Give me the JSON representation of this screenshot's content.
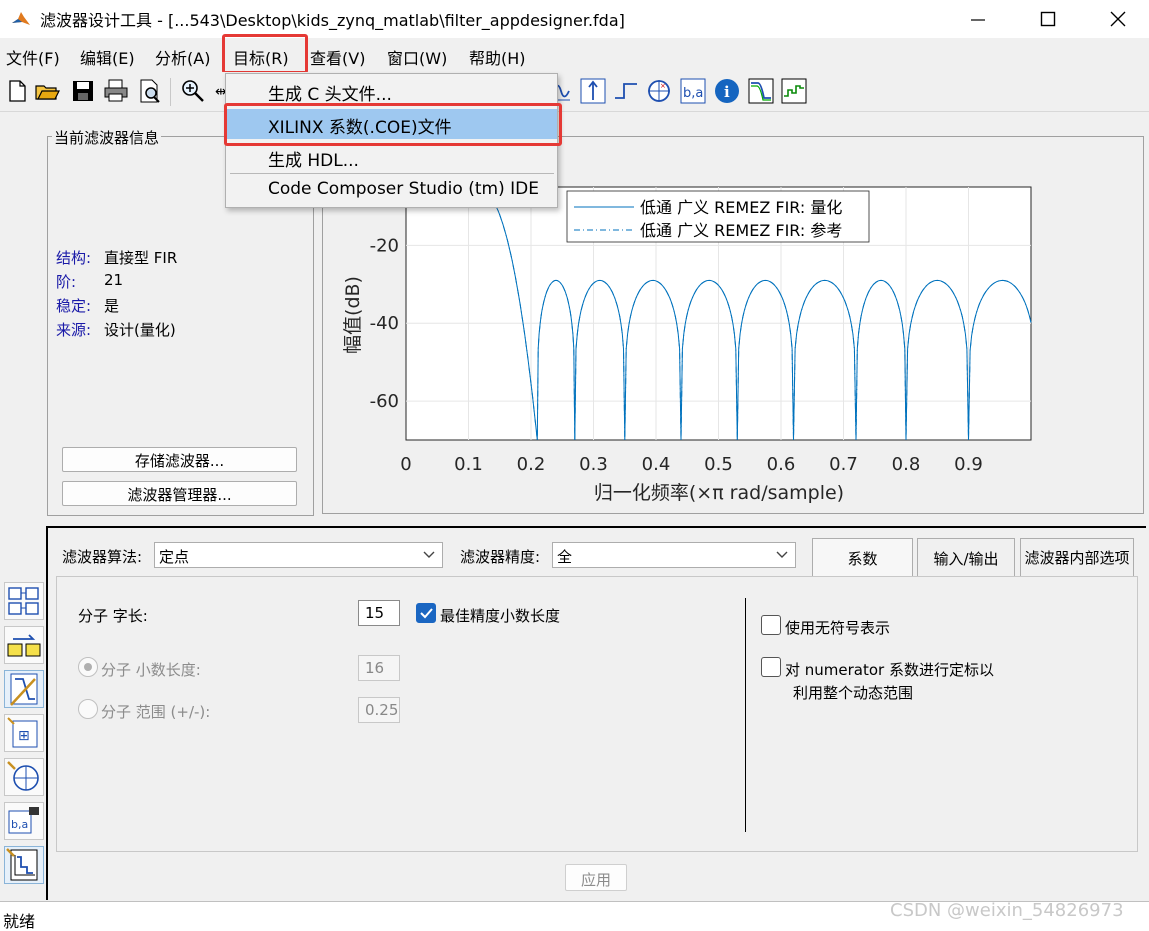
{
  "window": {
    "title": "滤波器设计工具 - [...543\\Desktop\\kids_zynq_matlab\\filter_appdesigner.fda]",
    "controls": [
      "minimize-icon",
      "maximize-icon",
      "close-icon"
    ]
  },
  "menubar": {
    "items": [
      "文件(F)",
      "编辑(E)",
      "分析(A)",
      "目标(R)",
      "查看(V)",
      "窗口(W)",
      "帮助(H)"
    ],
    "open_item": "目标(R)"
  },
  "target_menu": {
    "items": [
      "生成 C 头文件...",
      "XILINX 系数(.COE)文件",
      "生成 HDL...",
      "Code Composer Studio (tm) IDE"
    ],
    "highlighted": "XILINX 系数(.COE)文件"
  },
  "toolbar": {
    "icons": [
      "new-file-icon",
      "open-folder-icon",
      "save-icon",
      "print-icon",
      "print-preview-icon",
      "zoom-in-icon",
      "zoom-x-icon",
      "pole-zero-icon",
      "impulse-response-icon",
      "step-response-icon",
      "pole-zero-plot-icon",
      "filter-coefficients-icon",
      "info-icon",
      "group-delay-icon",
      "magnitude-estimate-icon"
    ]
  },
  "left_strip": {
    "icons": [
      "transform-filter-icon",
      "convert-structure-icon",
      "design-filter-icon",
      "import-filter-icon",
      "pole-zero-editor-icon",
      "multirate-icon",
      "quantize-icon"
    ]
  },
  "filter_info": {
    "group_title": "当前滤波器信息",
    "rows": [
      {
        "key": "结构:",
        "value": "直接型 FIR"
      },
      {
        "key": "阶:",
        "value": "21"
      },
      {
        "key": "稳定:",
        "value": "是"
      },
      {
        "key": "来源:",
        "value": "设计(量化)"
      }
    ],
    "store_button": "存储滤波器...",
    "manager_button": "滤波器管理器..."
  },
  "chart_data": {
    "type": "line",
    "xlabel": "归一化频率(×π rad/sample)",
    "ylabel": "幅值(dB)",
    "xlim": [
      0,
      1
    ],
    "ylim": [
      -70,
      -5
    ],
    "xticks": [
      "0",
      "0.1",
      "0.2",
      "0.3",
      "0.4",
      "0.5",
      "0.6",
      "0.7",
      "0.8",
      "0.9"
    ],
    "yticks": [
      "-20",
      "-40",
      "-60"
    ],
    "grid": true,
    "legend_position": "top-right",
    "series": [
      {
        "name": "低通 广义 REMEZ FIR: 量化",
        "style": "solid",
        "color": "#0072bd"
      },
      {
        "name": "低通 广义 REMEZ FIR: 参考",
        "style": "dashdot",
        "color": "#0072bd"
      }
    ],
    "passband_end": 0.1,
    "stopband_nulls": [
      0.21,
      0.27,
      0.35,
      0.44,
      0.53,
      0.62,
      0.72,
      0.8,
      0.9
    ],
    "sidelobe_peaks_db": [
      -29,
      -29,
      -29,
      -29,
      -29,
      -29,
      -29,
      -29,
      -29
    ]
  },
  "quantization": {
    "algorithm_label": "滤波器算法:",
    "algorithm_value": "定点",
    "precision_label": "滤波器精度:",
    "precision_value": "全",
    "tabs": [
      "系数",
      "输入/输出",
      "滤波器内部选项"
    ],
    "active_tab": "系数",
    "numerator_wordlength_label": "分子 字长:",
    "numerator_wordlength_value": "15",
    "best_precision_label": "最佳精度小数长度",
    "numerator_fraclength_label": "分子 小数长度:",
    "numerator_fraclength_value": "16",
    "numerator_range_label": "分子 范围 (+/-):",
    "numerator_range_value": "0.25",
    "unsigned_label": "使用无符号表示",
    "scale_label_line1": "对 numerator 系数进行定标以",
    "scale_label_line2": "利用整个动态范围",
    "apply_button": "应用"
  },
  "status": {
    "text": "就绪",
    "watermark": "CSDN @weixin_54826973"
  }
}
